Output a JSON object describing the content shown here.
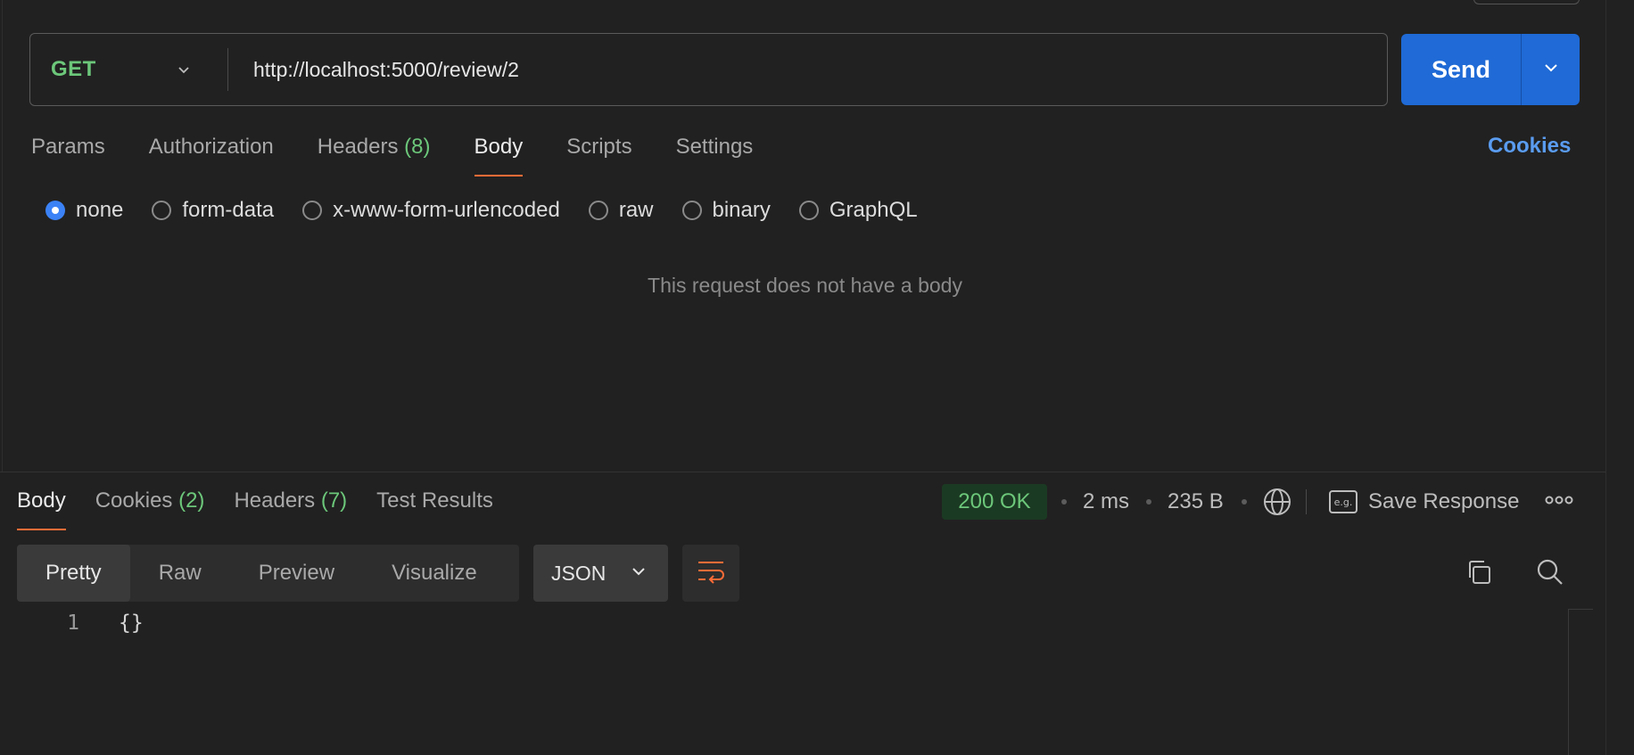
{
  "request": {
    "method": "GET",
    "url": "http://localhost:5000/review/2",
    "send_label": "Send"
  },
  "request_tabs": [
    {
      "label": "Params",
      "count": ""
    },
    {
      "label": "Authorization",
      "count": ""
    },
    {
      "label": "Headers",
      "count": "(8)"
    },
    {
      "label": "Body",
      "count": "",
      "active": true
    },
    {
      "label": "Scripts",
      "count": ""
    },
    {
      "label": "Settings",
      "count": ""
    }
  ],
  "cookies_link": "Cookies",
  "body_types": [
    {
      "label": "none",
      "selected": true
    },
    {
      "label": "form-data"
    },
    {
      "label": "x-www-form-urlencoded"
    },
    {
      "label": "raw"
    },
    {
      "label": "binary"
    },
    {
      "label": "GraphQL"
    }
  ],
  "no_body_message": "This request does not have a body",
  "response_tabs": [
    {
      "label": "Body",
      "count": "",
      "active": true
    },
    {
      "label": "Cookies",
      "count": "(2)"
    },
    {
      "label": "Headers",
      "count": "(7)"
    },
    {
      "label": "Test Results",
      "count": ""
    }
  ],
  "response_meta": {
    "status": "200 OK",
    "time": "2 ms",
    "size": "235 B",
    "save_label": "Save Response",
    "eg_label": "e.g."
  },
  "view_modes": [
    {
      "label": "Pretty",
      "active": true
    },
    {
      "label": "Raw"
    },
    {
      "label": "Preview"
    },
    {
      "label": "Visualize"
    }
  ],
  "format": "JSON",
  "code_lines": [
    {
      "num": "1",
      "text": "{}"
    }
  ],
  "colors": {
    "accent_orange": "#ff6c37",
    "send_blue": "#1f6ad6",
    "success_green": "#6cc77a",
    "link_blue": "#5a9cf0"
  }
}
